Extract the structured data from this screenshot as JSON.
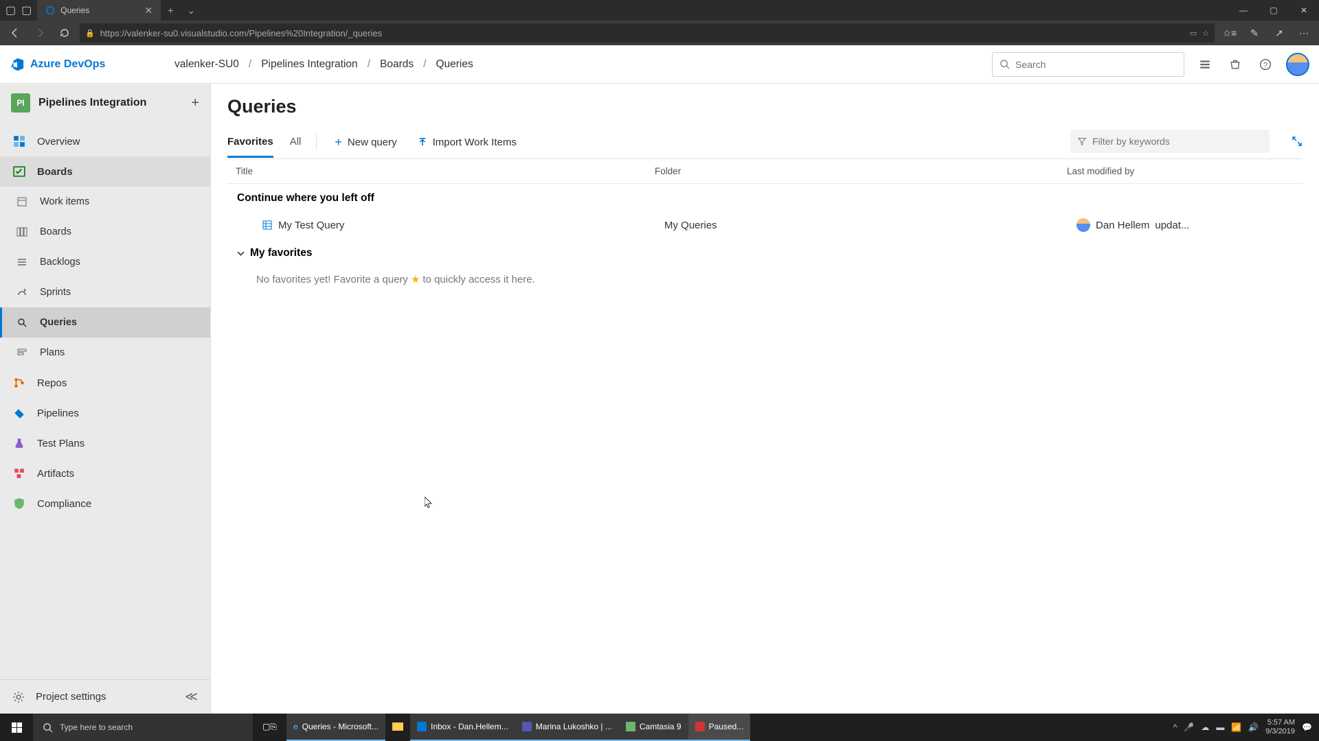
{
  "browser": {
    "tab_title": "Queries",
    "url": "https://valenker-su0.visualstudio.com/Pipelines%20Integration/_queries"
  },
  "header": {
    "product": "Azure DevOps",
    "breadcrumb": [
      "valenker-SU0",
      "Pipelines Integration",
      "Boards",
      "Queries"
    ],
    "search_placeholder": "Search"
  },
  "sidebar": {
    "project_initials": "PI",
    "project_name": "Pipelines Integration",
    "items": {
      "overview": "Overview",
      "boards": "Boards",
      "work_items": "Work items",
      "boards_sub": "Boards",
      "backlogs": "Backlogs",
      "sprints": "Sprints",
      "queries": "Queries",
      "plans": "Plans",
      "repos": "Repos",
      "pipelines": "Pipelines",
      "test_plans": "Test Plans",
      "artifacts": "Artifacts",
      "compliance": "Compliance"
    },
    "project_settings": "Project settings"
  },
  "main": {
    "title": "Queries",
    "tabs": {
      "favorites": "Favorites",
      "all": "All"
    },
    "new_query": "New query",
    "import": "Import Work Items",
    "filter_placeholder": "Filter by keywords",
    "cols": {
      "title": "Title",
      "folder": "Folder",
      "mod": "Last modified by"
    },
    "continue_header": "Continue where you left off",
    "row": {
      "title": "My Test Query",
      "folder": "My Queries",
      "mod_name": "Dan Hellem",
      "mod_suffix": "updat..."
    },
    "fav_header": "My favorites",
    "fav_empty_pre": "No favorites yet! Favorite a query",
    "fav_empty_post": "to quickly access it here."
  },
  "taskbar": {
    "search_placeholder": "Type here to search",
    "apps": {
      "edge": "Queries - Microsoft...",
      "outlook": "Inbox - Dan.Hellem...",
      "teams": "Marina Lukoshko | ...",
      "camtasia": "Camtasia 9",
      "recorder": "Paused..."
    },
    "time": "5:57 AM",
    "date": "9/3/2019"
  }
}
